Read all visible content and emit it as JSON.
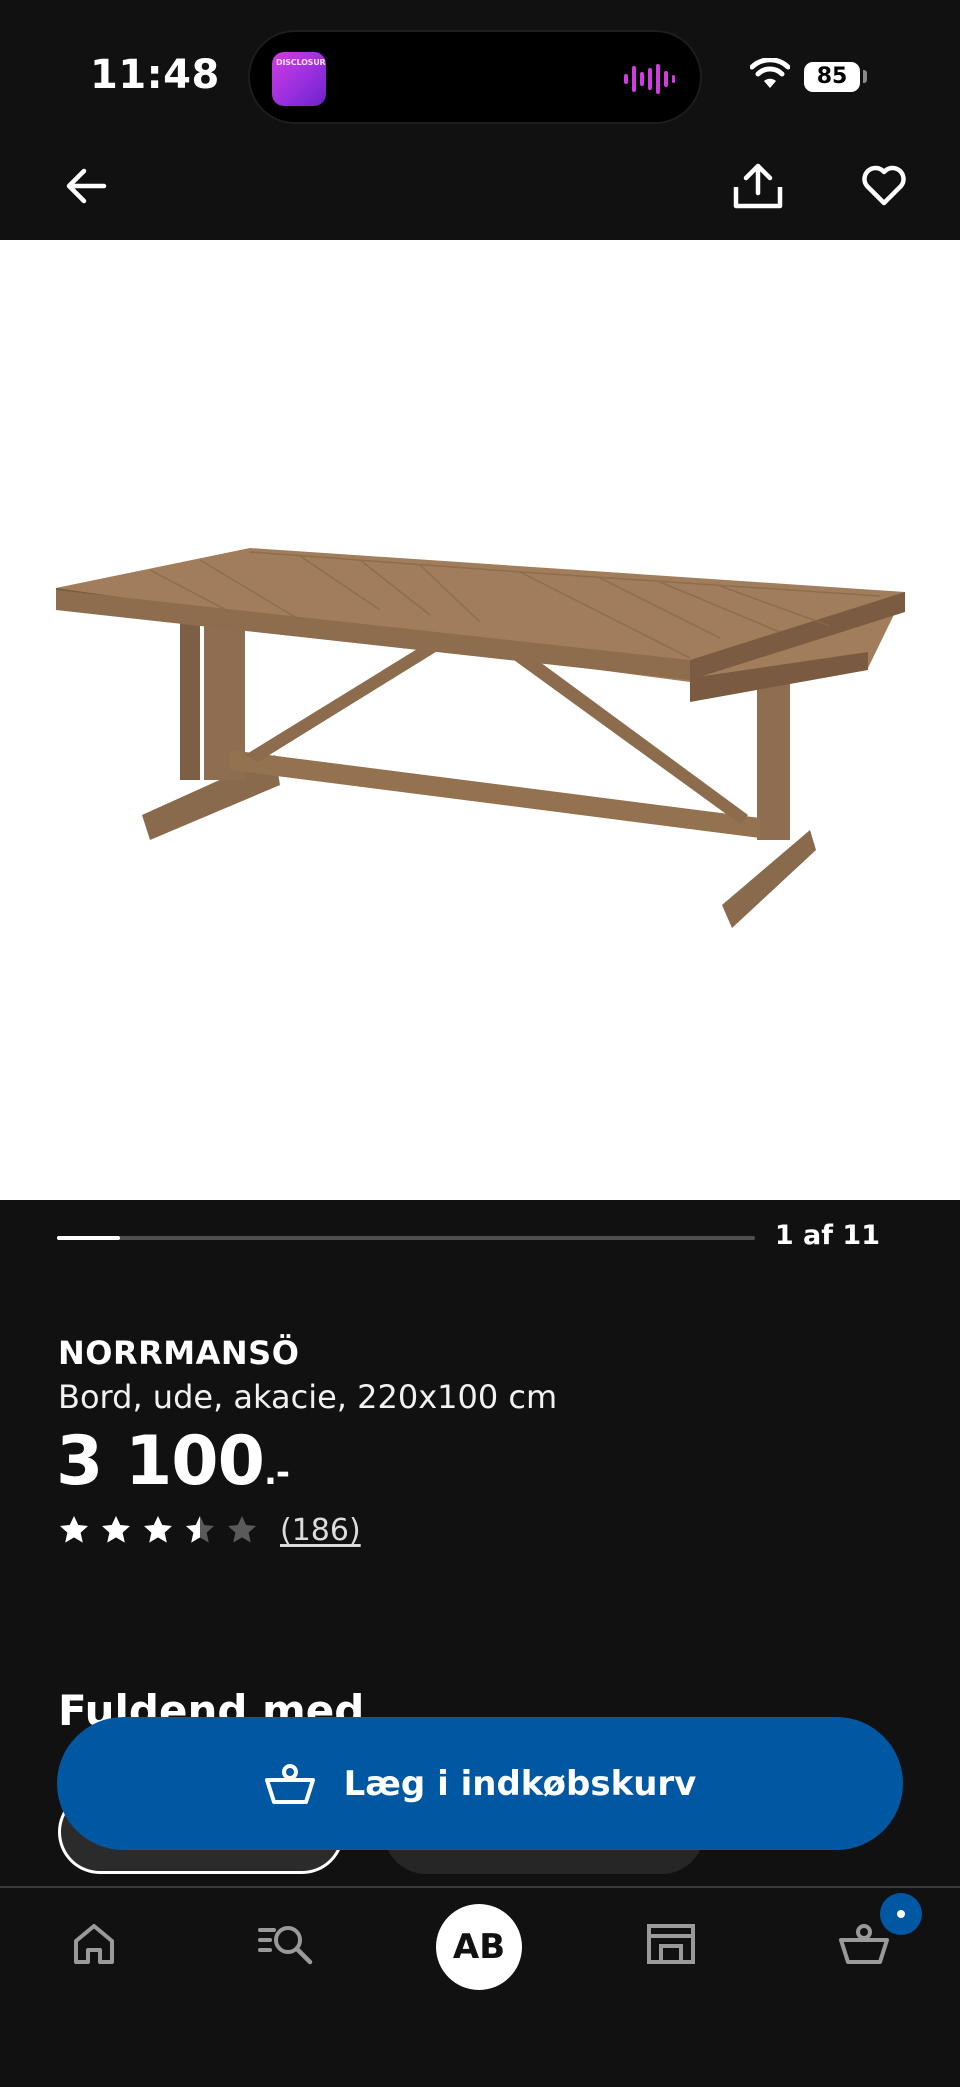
{
  "status_bar": {
    "time": "11:48",
    "battery": "85",
    "island_app_label": "DISCLOSURE",
    "accent_color": "#d13ce0"
  },
  "nav": {
    "back_icon": "arrow-left-icon",
    "share_icon": "share-icon",
    "favorite_icon": "heart-icon"
  },
  "gallery": {
    "counter": "1 af 11",
    "current": 1,
    "total": 11
  },
  "product": {
    "name": "NORRMANSÖ",
    "description": "Bord, ude, akacie, 220x100 cm",
    "price": "3 100",
    "price_suffix": ".-",
    "rating": 3.5,
    "rating_max": 5,
    "review_count": "(186)"
  },
  "section": {
    "title": "Fuldend med"
  },
  "cta": {
    "label": "Læg i indkøbskurv",
    "icon": "basket-icon",
    "color": "#0058a3"
  },
  "tabbar": {
    "home_icon": "home-icon",
    "search_icon": "search-list-icon",
    "profile_initials": "AB",
    "stores_icon": "store-icon",
    "cart_icon": "basket-icon"
  }
}
